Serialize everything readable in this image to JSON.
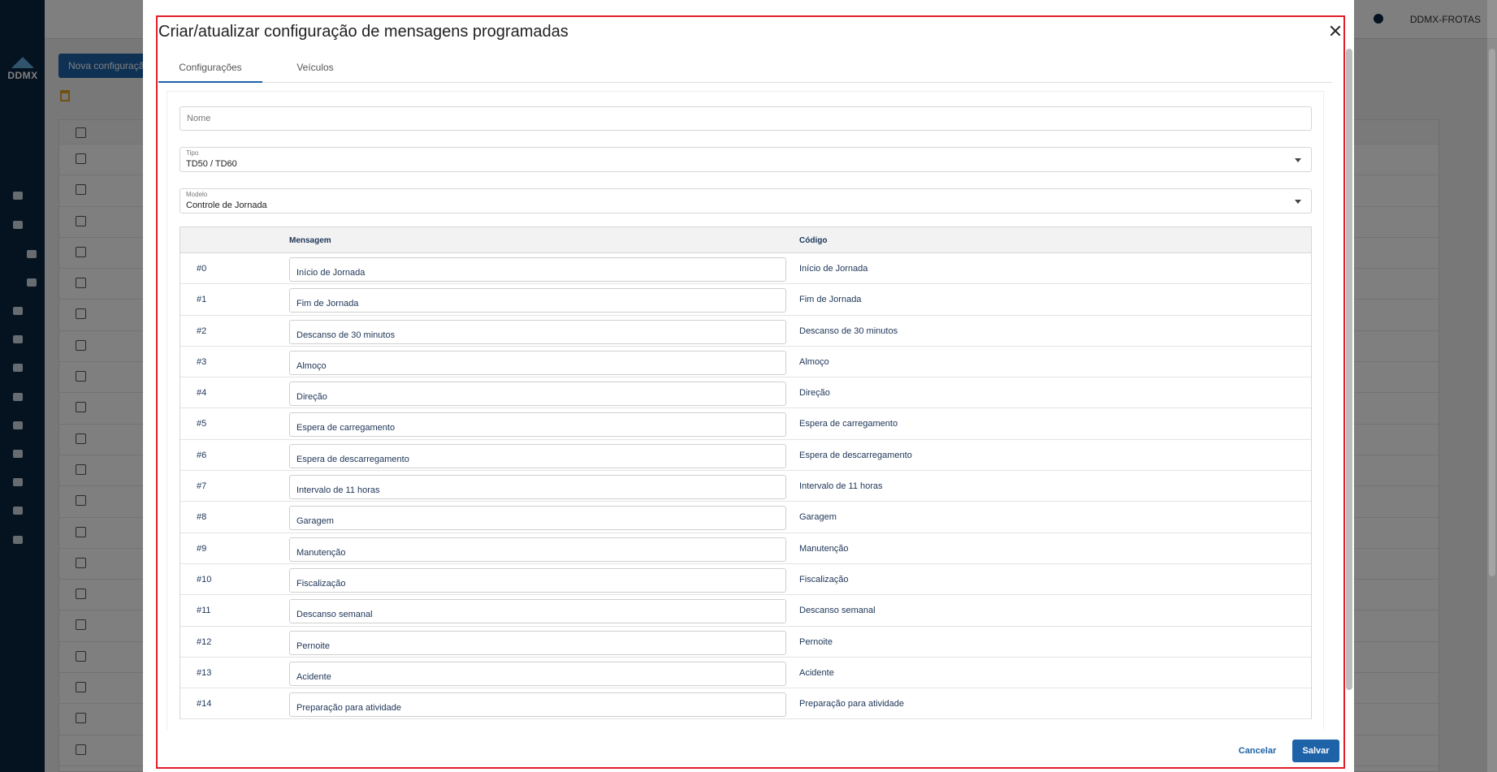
{
  "background": {
    "logo_text": "DDMX",
    "new_config_button": "Nova configuração",
    "user_label": "DDMX-FROTAS"
  },
  "dialog": {
    "title": "Criar/atualizar configuração de mensagens programadas",
    "tabs": [
      {
        "label": "Configurações",
        "active": true
      },
      {
        "label": "Veículos",
        "active": false
      }
    ],
    "name_field": {
      "placeholder": "Nome",
      "value": ""
    },
    "type_field": {
      "label": "Tipo",
      "value": "TD50 / TD60"
    },
    "model_field": {
      "label": "Modelo",
      "value": "Controle de Jornada"
    },
    "table": {
      "columns": [
        "",
        "Mensagem",
        "Código"
      ],
      "rows": [
        {
          "index": "#0",
          "message": "Início de Jornada",
          "code": "Início de Jornada"
        },
        {
          "index": "#1",
          "message": "Fim de Jornada",
          "code": "Fim de Jornada"
        },
        {
          "index": "#2",
          "message": "Descanso de 30 minutos",
          "code": "Descanso de 30 minutos"
        },
        {
          "index": "#3",
          "message": "Almoço",
          "code": "Almoço"
        },
        {
          "index": "#4",
          "message": "Direção",
          "code": "Direção"
        },
        {
          "index": "#5",
          "message": "Espera de carregamento",
          "code": "Espera de carregamento"
        },
        {
          "index": "#6",
          "message": "Espera de descarregamento",
          "code": "Espera de descarregamento"
        },
        {
          "index": "#7",
          "message": "Intervalo de 11 horas",
          "code": "Intervalo de 11 horas"
        },
        {
          "index": "#8",
          "message": "Garagem",
          "code": "Garagem"
        },
        {
          "index": "#9",
          "message": "Manutenção",
          "code": "Manutenção"
        },
        {
          "index": "#10",
          "message": "Fiscalização",
          "code": "Fiscalização"
        },
        {
          "index": "#11",
          "message": "Descanso semanal",
          "code": "Descanso semanal"
        },
        {
          "index": "#12",
          "message": "Pernoite",
          "code": "Pernoite"
        },
        {
          "index": "#13",
          "message": "Acidente",
          "code": "Acidente"
        },
        {
          "index": "#14",
          "message": "Preparação para atividade",
          "code": "Preparação para atividade"
        }
      ]
    },
    "cancel_button": "Cancelar",
    "save_button": "Salvar"
  },
  "colors": {
    "sidebar": "#0a2540",
    "primary": "#1e63a8",
    "highlight_frame": "#e11d2a"
  }
}
